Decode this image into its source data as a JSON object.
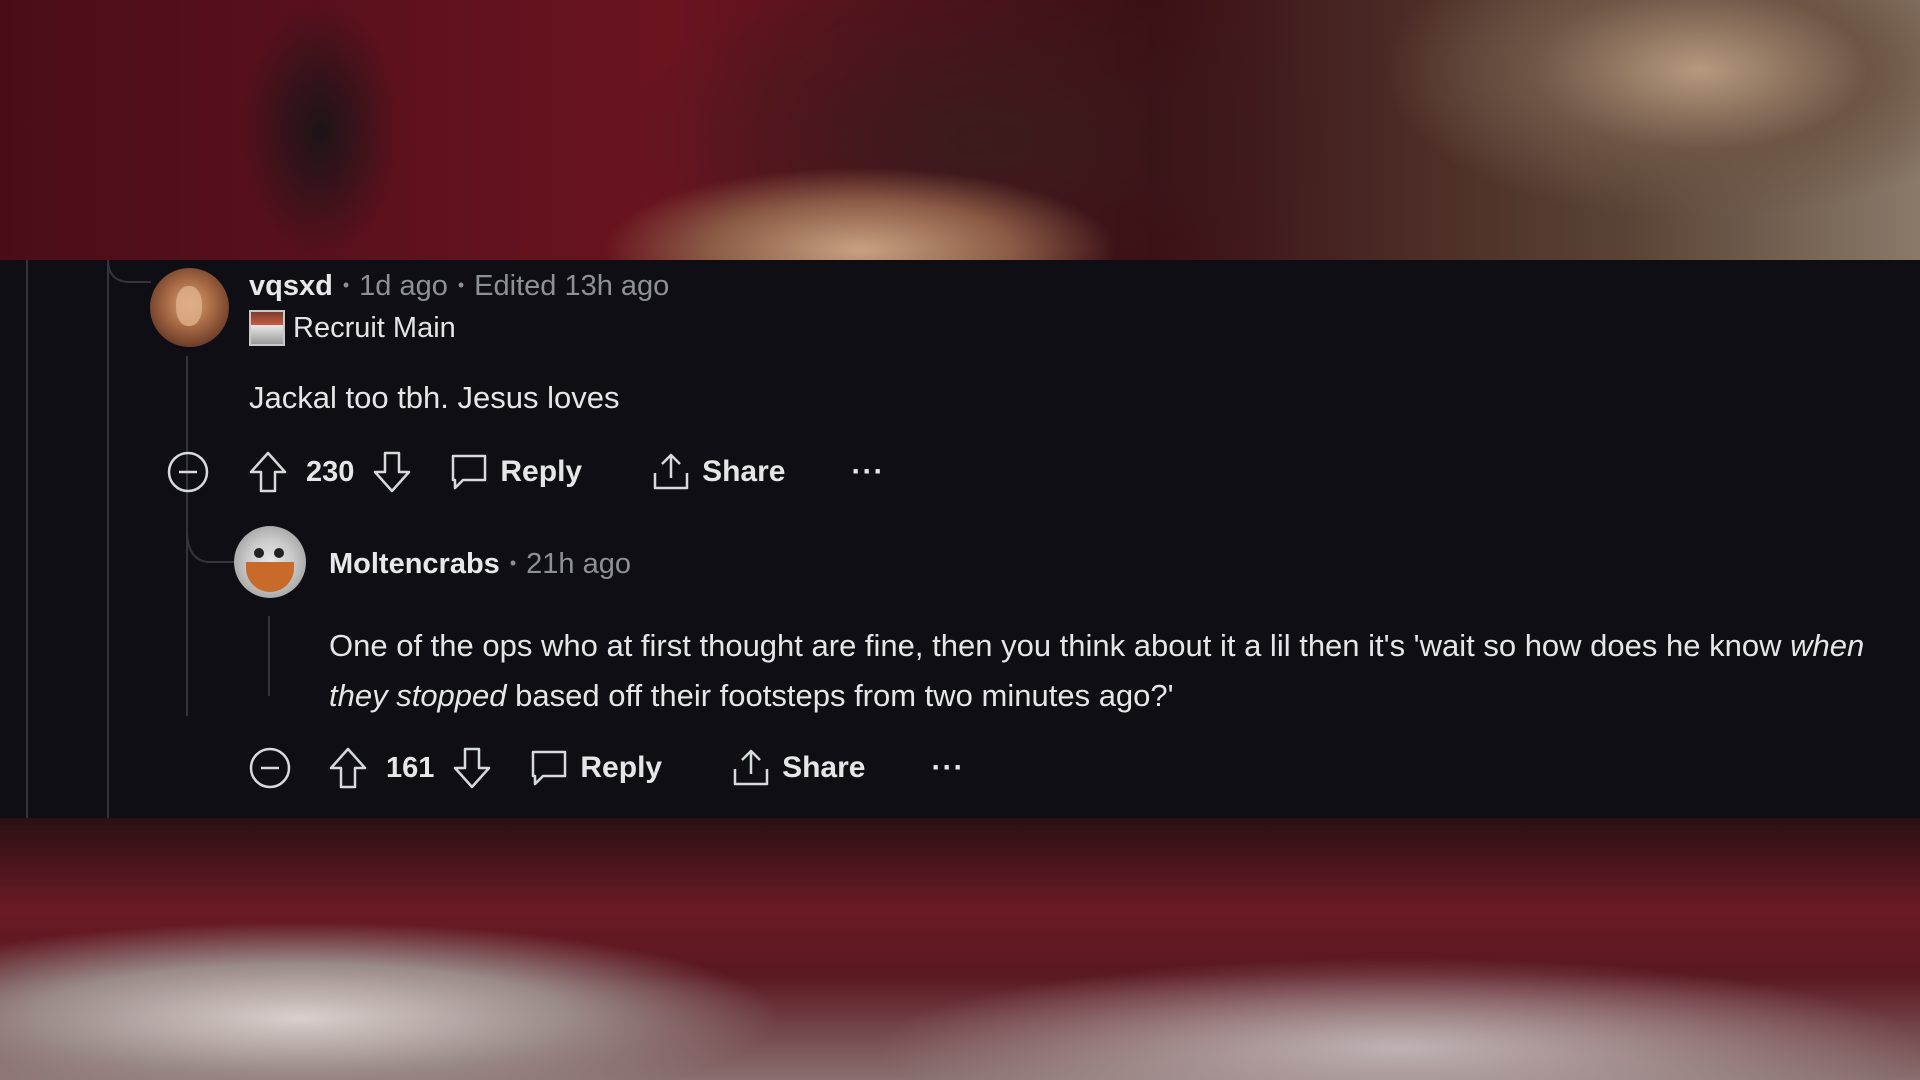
{
  "comments": [
    {
      "username": "vqsxd",
      "time": "1d ago",
      "edited": "Edited 13h ago",
      "flair": "Recruit Main",
      "body": "Jackal too tbh. Jesus loves",
      "score": "230",
      "reply_label": "Reply",
      "share_label": "Share",
      "more_label": "···"
    },
    {
      "username": "Moltencrabs",
      "time": "21h ago",
      "body_before": "One of the ops who at first thought are fine, then you think about it a lil then it's 'wait so how does he know ",
      "body_emphasis": "when they stopped",
      "body_after": " based off their footsteps from two minutes ago?'",
      "score": "161",
      "reply_label": "Reply",
      "share_label": "Share",
      "more_label": "···"
    }
  ]
}
